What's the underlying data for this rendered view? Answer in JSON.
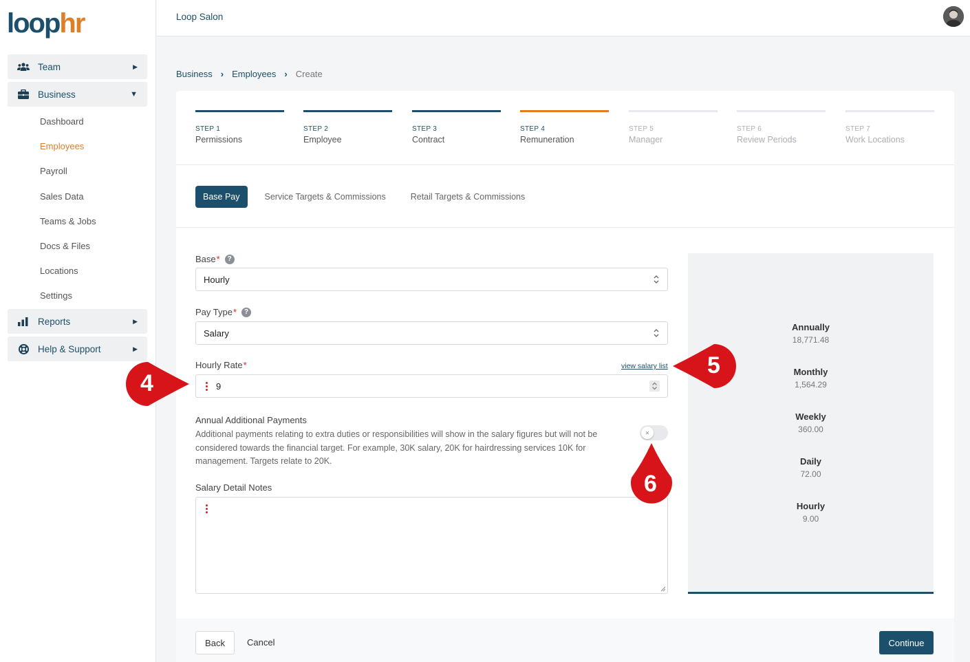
{
  "app": {
    "logo_part1": "loop",
    "logo_part2": "hr",
    "company": "Loop Salon"
  },
  "sidebar": {
    "groups": [
      {
        "label": "Team",
        "icon": "users-icon",
        "expanded": false
      },
      {
        "label": "Business",
        "icon": "briefcase-icon",
        "expanded": true
      },
      {
        "label": "Reports",
        "icon": "bar-chart-icon",
        "expanded": false
      },
      {
        "label": "Help & Support",
        "icon": "life-ring-icon",
        "expanded": false
      }
    ],
    "business_items": [
      "Dashboard",
      "Employees",
      "Payroll",
      "Sales Data",
      "Teams & Jobs",
      "Docs & Files",
      "Locations",
      "Settings"
    ],
    "active_item": "Employees"
  },
  "breadcrumb": [
    "Business",
    "Employees",
    "Create"
  ],
  "steps": [
    {
      "num": "STEP 1",
      "name": "Permissions",
      "state": "done"
    },
    {
      "num": "STEP 2",
      "name": "Employee",
      "state": "done"
    },
    {
      "num": "STEP 3",
      "name": "Contract",
      "state": "done"
    },
    {
      "num": "STEP 4",
      "name": "Remuneration",
      "state": "current"
    },
    {
      "num": "STEP 5",
      "name": "Manager",
      "state": "future"
    },
    {
      "num": "STEP 6",
      "name": "Review Periods",
      "state": "future"
    },
    {
      "num": "STEP 7",
      "name": "Work Locations",
      "state": "future"
    }
  ],
  "tabs": [
    "Base Pay",
    "Service Targets & Commissions",
    "Retail Targets & Commissions"
  ],
  "form": {
    "base_label": "Base",
    "base_value": "Hourly",
    "pay_type_label": "Pay Type",
    "pay_type_value": "Salary",
    "hourly_rate_label": "Hourly Rate",
    "hourly_rate_value": "9",
    "view_salary_link": "view salary list",
    "annual_title": "Annual Additional Payments",
    "annual_desc": "Additional payments relating to extra duties or responsibilities will show in the salary figures but will not be considered towards the financial target. For example, 30K salary, 20K for hairdressing services 10K for management. Targets relate to 20K.",
    "annual_toggle_on": false,
    "notes_label": "Salary Detail Notes",
    "required_mark": "*",
    "help_glyph": "?"
  },
  "summary": [
    {
      "label": "Annually",
      "value": "18,771.48"
    },
    {
      "label": "Monthly",
      "value": "1,564.29"
    },
    {
      "label": "Weekly",
      "value": "360.00"
    },
    {
      "label": "Daily",
      "value": "72.00"
    },
    {
      "label": "Hourly",
      "value": "9.00"
    }
  ],
  "footer": {
    "back": "Back",
    "cancel": "Cancel",
    "continue": "Continue"
  },
  "markers": [
    "4",
    "5",
    "6"
  ],
  "colors": {
    "brand": "#1c4f6b",
    "accent": "#e07e27",
    "marker": "#d7141a"
  }
}
